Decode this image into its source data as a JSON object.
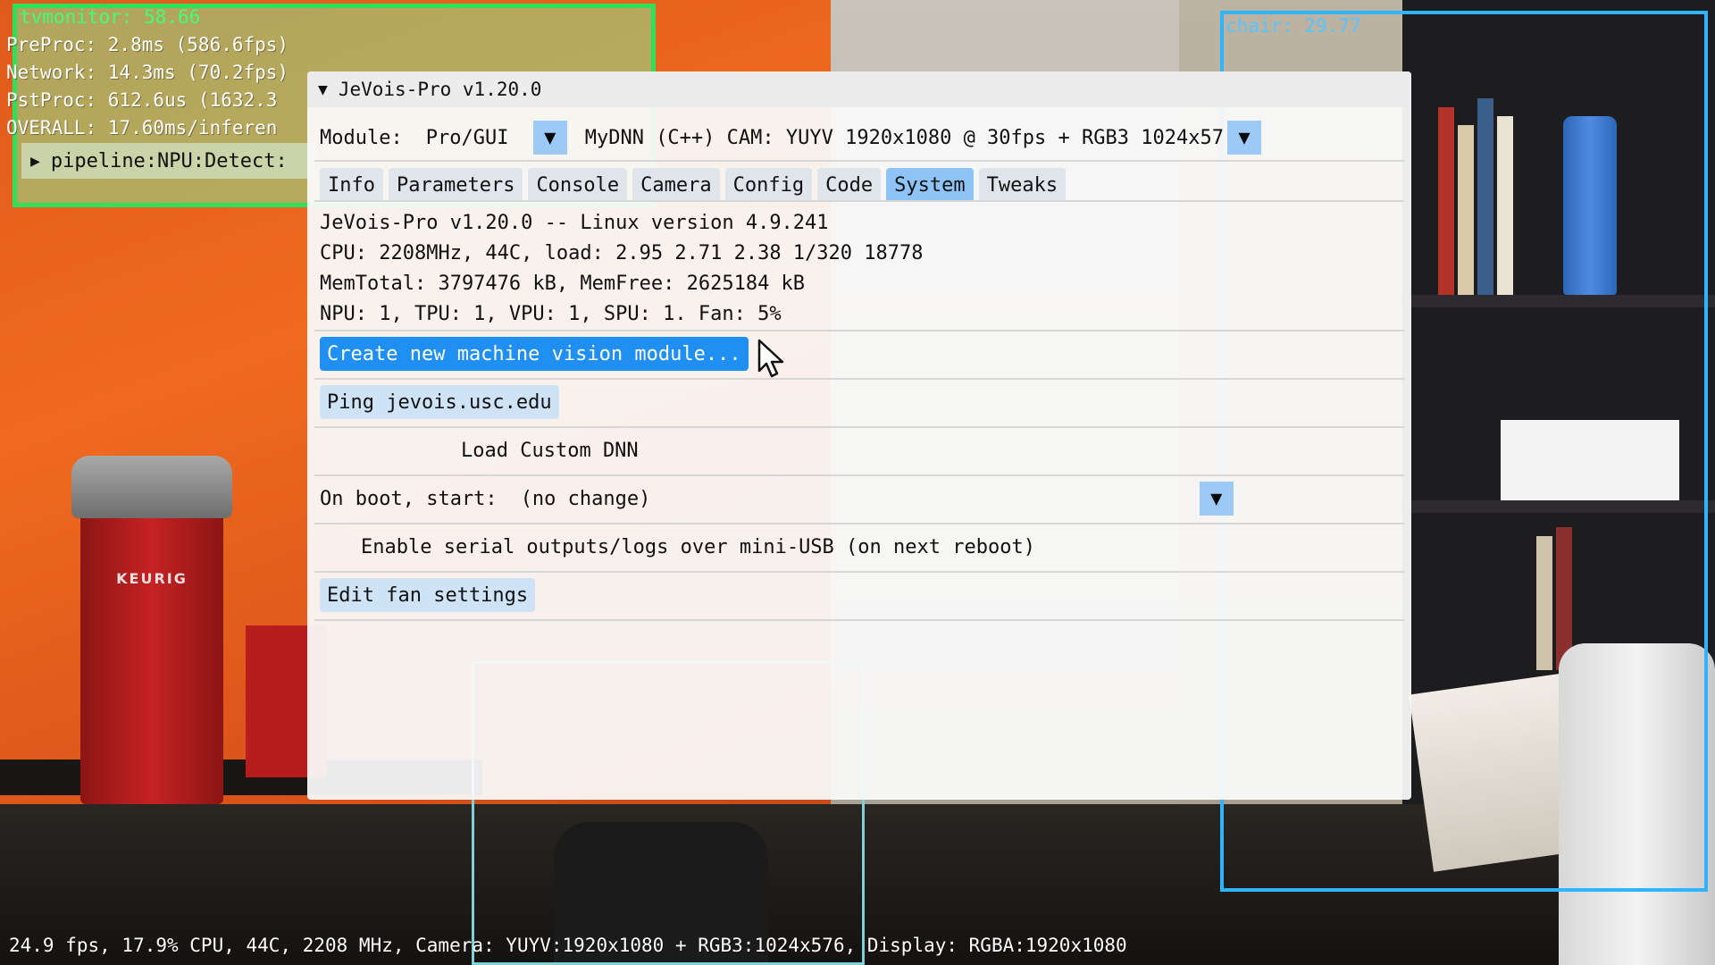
{
  "overlay": {
    "detection_green_label": "tvmonitor: 58.66",
    "detection_blue_label": "chair: 29.77",
    "stats": [
      "PreProc: 2.8ms (586.6fps)",
      "Network: 14.3ms (70.2fps)",
      "PstProc: 612.6us (1632.3",
      "OVERALL: 17.60ms/inferen"
    ],
    "pipeline_label": "pipeline:NPU:Detect:"
  },
  "status_bar": {
    "text": "24.9 fps, 17.9% CPU, 44C, 2208 MHz, Camera: YUYV:1920x1080 + RGB3:1024x576, Display: RGBA:1920x1080"
  },
  "window": {
    "title": "JeVois-Pro v1.20.0",
    "module_label": "Module:",
    "module_value": "Pro/GUI",
    "module_description": "MyDNN (C++) CAM: YUYV 1920x1080 @ 30fps + RGB3 1024x57",
    "tabs": [
      {
        "label": "Info",
        "active": false
      },
      {
        "label": "Parameters",
        "active": false
      },
      {
        "label": "Console",
        "active": false
      },
      {
        "label": "Camera",
        "active": false
      },
      {
        "label": "Config",
        "active": false
      },
      {
        "label": "Code",
        "active": false
      },
      {
        "label": "System",
        "active": true
      },
      {
        "label": "Tweaks",
        "active": false
      }
    ],
    "system_info": [
      "JeVois-Pro v1.20.0 -- Linux version 4.9.241",
      "CPU: 2208MHz, 44C, load: 2.95 2.71 2.38 1/320 18778",
      "MemTotal: 3797476 kB, MemFree: 2625184 kB",
      "NPU: 1, TPU: 1, VPU: 1, SPU: 1. Fan: 5%"
    ],
    "create_module_button": "Create new machine vision module...",
    "ping_button": "Ping jevois.usc.edu",
    "load_dnn_label": "Load Custom DNN",
    "on_boot_label": "On boot, start:",
    "on_boot_value": "(no change)",
    "serial_label": "Enable serial outputs/logs over mini-USB (on next reboot)",
    "fan_button": "Edit fan settings"
  },
  "colors": {
    "tab_active": "#8ec3f5",
    "button": "#cfe3f7",
    "button_hover": "#1f8ff2",
    "detection_green": "#2fe05a",
    "detection_blue": "#31b4ff"
  }
}
